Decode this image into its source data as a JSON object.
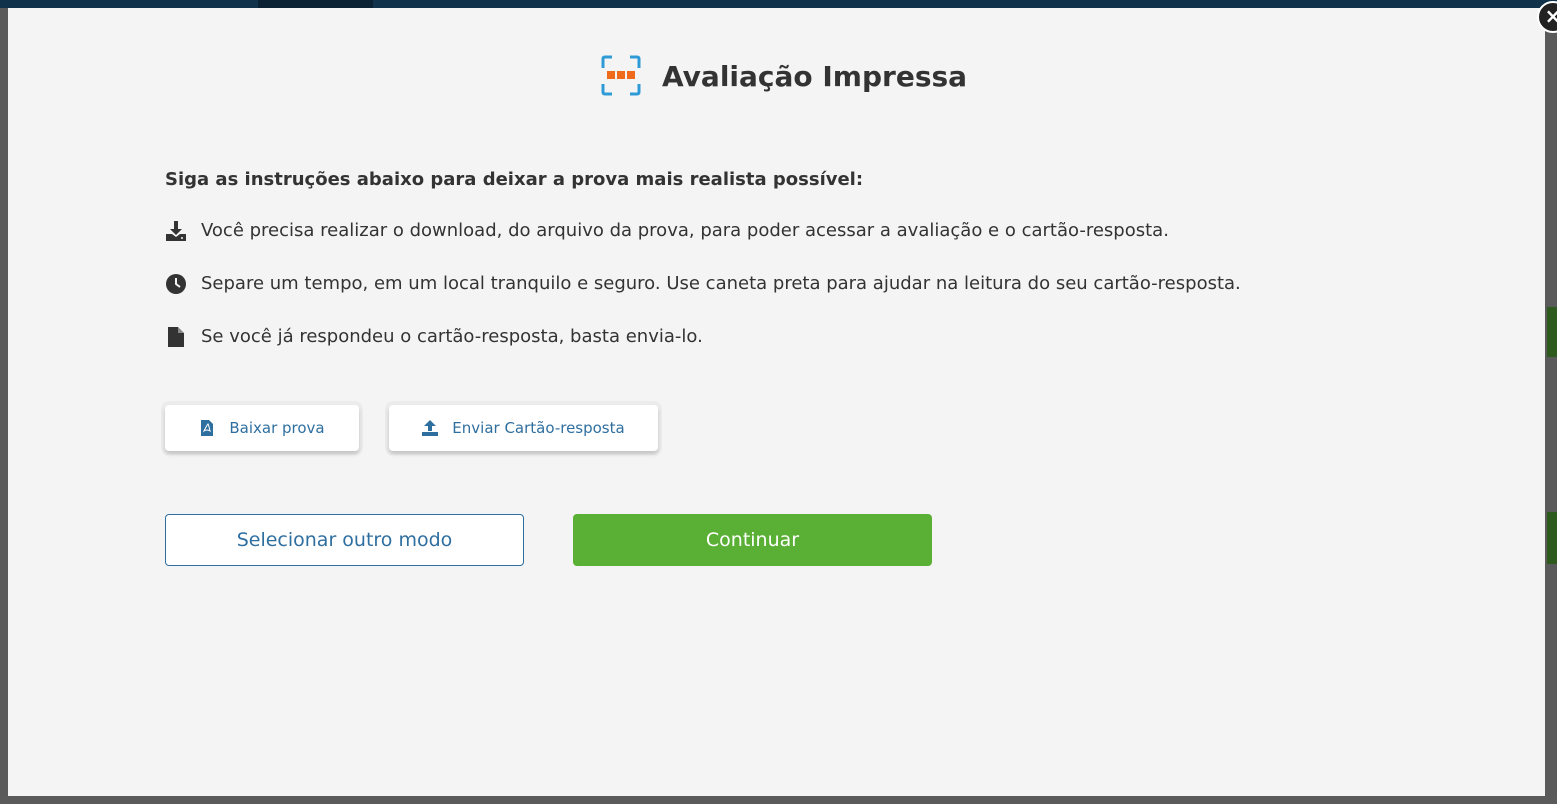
{
  "modal": {
    "title": "Avaliação Impressa",
    "close_label": "×",
    "intro": "Siga as instruções abaixo para deixar a prova mais realista possível:",
    "instructions": [
      {
        "icon": "download-icon",
        "text": "Você precisa realizar o download, do arquivo da prova, para poder acessar a avaliação e o cartão-resposta."
      },
      {
        "icon": "clock-icon",
        "text": "Separe um tempo, em um local tranquilo e seguro. Use caneta preta para ajudar na leitura do seu cartão-resposta."
      },
      {
        "icon": "file-icon",
        "text": "Se você já respondeu o cartão-resposta, basta envia-lo."
      }
    ],
    "actions": {
      "download_label": "Baixar prova",
      "upload_label": "Enviar Cartão-resposta"
    },
    "footer": {
      "secondary_label": "Selecionar outro modo",
      "primary_label": "Continuar"
    }
  },
  "colors": {
    "accent_blue": "#2f6fa0",
    "primary_green": "#5ab034",
    "icon_orange": "#f06a1c",
    "icon_blue": "#2f9bd6",
    "text_dark": "#333333",
    "modal_bg": "#f4f4f4"
  }
}
